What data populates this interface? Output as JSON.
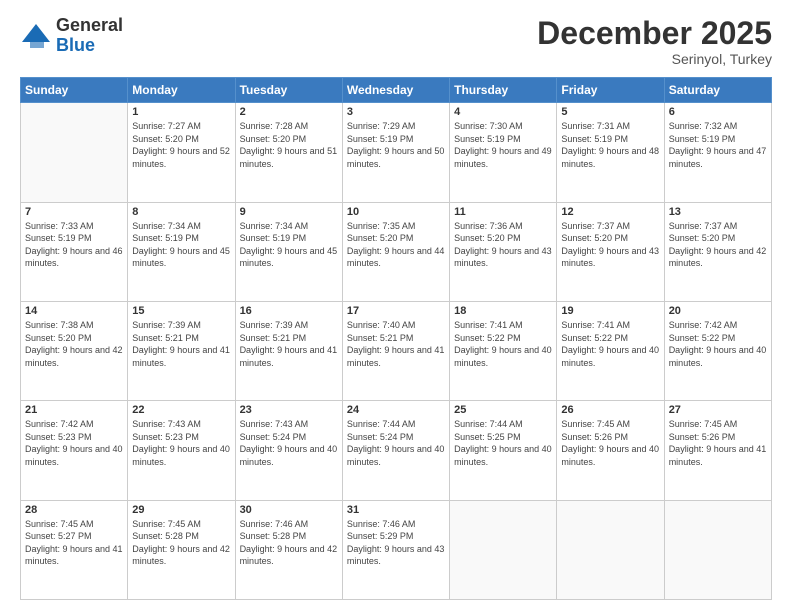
{
  "header": {
    "logo_line1": "General",
    "logo_line2": "Blue",
    "month_year": "December 2025",
    "location": "Serinyol, Turkey"
  },
  "days_of_week": [
    "Sunday",
    "Monday",
    "Tuesday",
    "Wednesday",
    "Thursday",
    "Friday",
    "Saturday"
  ],
  "weeks": [
    [
      {
        "day": "",
        "empty": true
      },
      {
        "day": "1",
        "sunrise": "7:27 AM",
        "sunset": "5:20 PM",
        "daylight": "9 hours and 52 minutes."
      },
      {
        "day": "2",
        "sunrise": "7:28 AM",
        "sunset": "5:20 PM",
        "daylight": "9 hours and 51 minutes."
      },
      {
        "day": "3",
        "sunrise": "7:29 AM",
        "sunset": "5:19 PM",
        "daylight": "9 hours and 50 minutes."
      },
      {
        "day": "4",
        "sunrise": "7:30 AM",
        "sunset": "5:19 PM",
        "daylight": "9 hours and 49 minutes."
      },
      {
        "day": "5",
        "sunrise": "7:31 AM",
        "sunset": "5:19 PM",
        "daylight": "9 hours and 48 minutes."
      },
      {
        "day": "6",
        "sunrise": "7:32 AM",
        "sunset": "5:19 PM",
        "daylight": "9 hours and 47 minutes."
      }
    ],
    [
      {
        "day": "7",
        "sunrise": "7:33 AM",
        "sunset": "5:19 PM",
        "daylight": "9 hours and 46 minutes."
      },
      {
        "day": "8",
        "sunrise": "7:34 AM",
        "sunset": "5:19 PM",
        "daylight": "9 hours and 45 minutes."
      },
      {
        "day": "9",
        "sunrise": "7:34 AM",
        "sunset": "5:19 PM",
        "daylight": "9 hours and 45 minutes."
      },
      {
        "day": "10",
        "sunrise": "7:35 AM",
        "sunset": "5:20 PM",
        "daylight": "9 hours and 44 minutes."
      },
      {
        "day": "11",
        "sunrise": "7:36 AM",
        "sunset": "5:20 PM",
        "daylight": "9 hours and 43 minutes."
      },
      {
        "day": "12",
        "sunrise": "7:37 AM",
        "sunset": "5:20 PM",
        "daylight": "9 hours and 43 minutes."
      },
      {
        "day": "13",
        "sunrise": "7:37 AM",
        "sunset": "5:20 PM",
        "daylight": "9 hours and 42 minutes."
      }
    ],
    [
      {
        "day": "14",
        "sunrise": "7:38 AM",
        "sunset": "5:20 PM",
        "daylight": "9 hours and 42 minutes."
      },
      {
        "day": "15",
        "sunrise": "7:39 AM",
        "sunset": "5:21 PM",
        "daylight": "9 hours and 41 minutes."
      },
      {
        "day": "16",
        "sunrise": "7:39 AM",
        "sunset": "5:21 PM",
        "daylight": "9 hours and 41 minutes."
      },
      {
        "day": "17",
        "sunrise": "7:40 AM",
        "sunset": "5:21 PM",
        "daylight": "9 hours and 41 minutes."
      },
      {
        "day": "18",
        "sunrise": "7:41 AM",
        "sunset": "5:22 PM",
        "daylight": "9 hours and 40 minutes."
      },
      {
        "day": "19",
        "sunrise": "7:41 AM",
        "sunset": "5:22 PM",
        "daylight": "9 hours and 40 minutes."
      },
      {
        "day": "20",
        "sunrise": "7:42 AM",
        "sunset": "5:22 PM",
        "daylight": "9 hours and 40 minutes."
      }
    ],
    [
      {
        "day": "21",
        "sunrise": "7:42 AM",
        "sunset": "5:23 PM",
        "daylight": "9 hours and 40 minutes."
      },
      {
        "day": "22",
        "sunrise": "7:43 AM",
        "sunset": "5:23 PM",
        "daylight": "9 hours and 40 minutes."
      },
      {
        "day": "23",
        "sunrise": "7:43 AM",
        "sunset": "5:24 PM",
        "daylight": "9 hours and 40 minutes."
      },
      {
        "day": "24",
        "sunrise": "7:44 AM",
        "sunset": "5:24 PM",
        "daylight": "9 hours and 40 minutes."
      },
      {
        "day": "25",
        "sunrise": "7:44 AM",
        "sunset": "5:25 PM",
        "daylight": "9 hours and 40 minutes."
      },
      {
        "day": "26",
        "sunrise": "7:45 AM",
        "sunset": "5:26 PM",
        "daylight": "9 hours and 40 minutes."
      },
      {
        "day": "27",
        "sunrise": "7:45 AM",
        "sunset": "5:26 PM",
        "daylight": "9 hours and 41 minutes."
      }
    ],
    [
      {
        "day": "28",
        "sunrise": "7:45 AM",
        "sunset": "5:27 PM",
        "daylight": "9 hours and 41 minutes."
      },
      {
        "day": "29",
        "sunrise": "7:45 AM",
        "sunset": "5:28 PM",
        "daylight": "9 hours and 42 minutes."
      },
      {
        "day": "30",
        "sunrise": "7:46 AM",
        "sunset": "5:28 PM",
        "daylight": "9 hours and 42 minutes."
      },
      {
        "day": "31",
        "sunrise": "7:46 AM",
        "sunset": "5:29 PM",
        "daylight": "9 hours and 43 minutes."
      },
      {
        "day": "",
        "empty": true
      },
      {
        "day": "",
        "empty": true
      },
      {
        "day": "",
        "empty": true
      }
    ]
  ]
}
